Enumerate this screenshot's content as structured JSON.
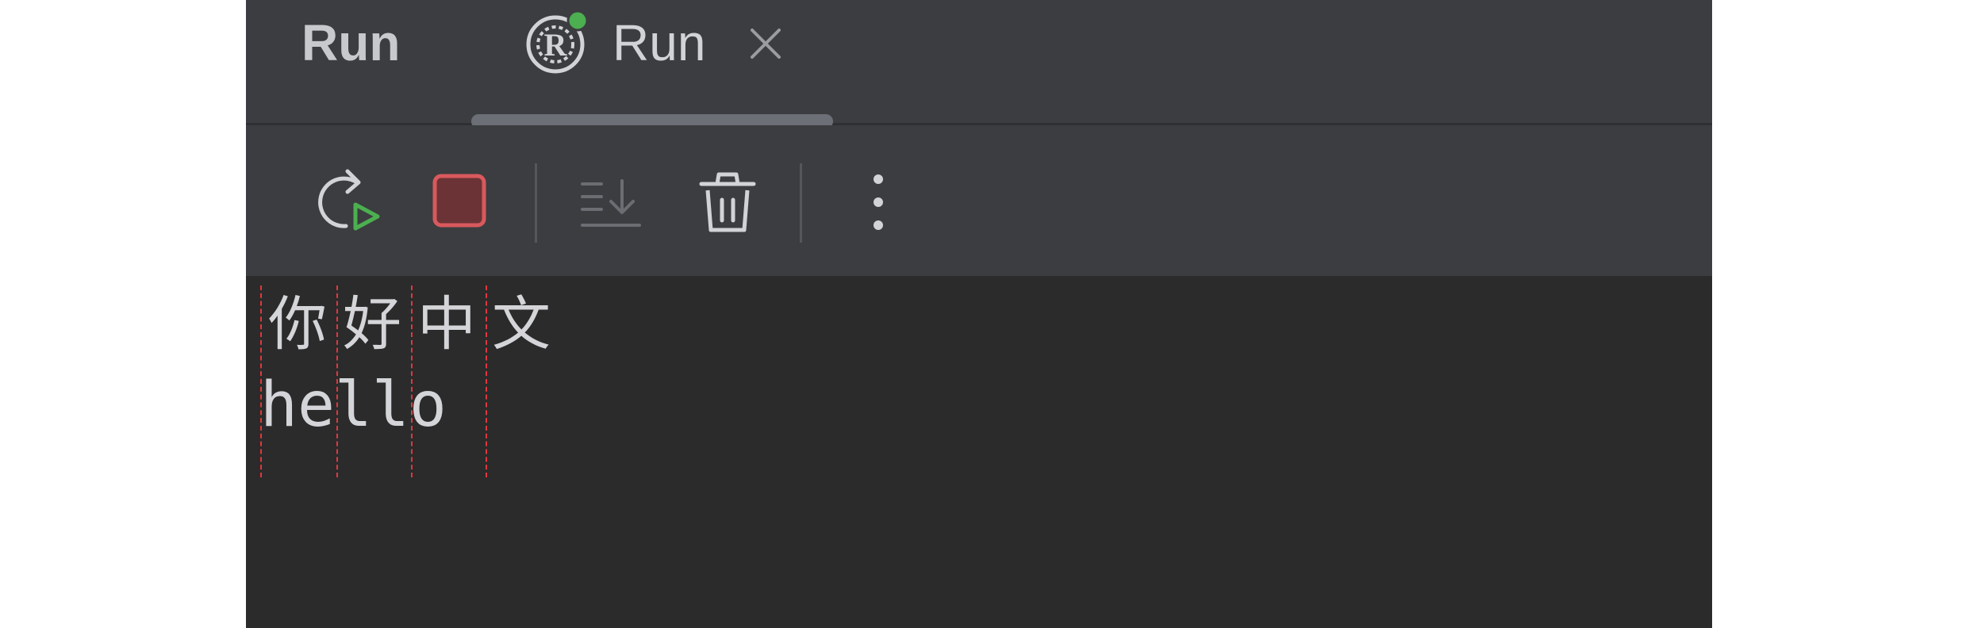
{
  "tool_window": {
    "title": "Run"
  },
  "tabs": [
    {
      "label": "Run",
      "icon": "rust-run-icon",
      "status_color": "#4caf50",
      "close_icon": "close-icon"
    }
  ],
  "toolbar": {
    "buttons": [
      {
        "icon": "rerun-icon",
        "accent": "#4caf50"
      },
      {
        "icon": "stop-icon",
        "accent": "#d9595d"
      },
      {
        "icon": "scroll-to-end-icon",
        "disabled": true
      },
      {
        "icon": "trash-icon"
      },
      {
        "icon": "more-vertical-icon"
      }
    ]
  },
  "console": {
    "lines": [
      {
        "chars": [
          "你",
          "好",
          "中",
          "文"
        ]
      },
      {
        "text": "hello"
      }
    ],
    "guide_color": "#e0383d"
  }
}
